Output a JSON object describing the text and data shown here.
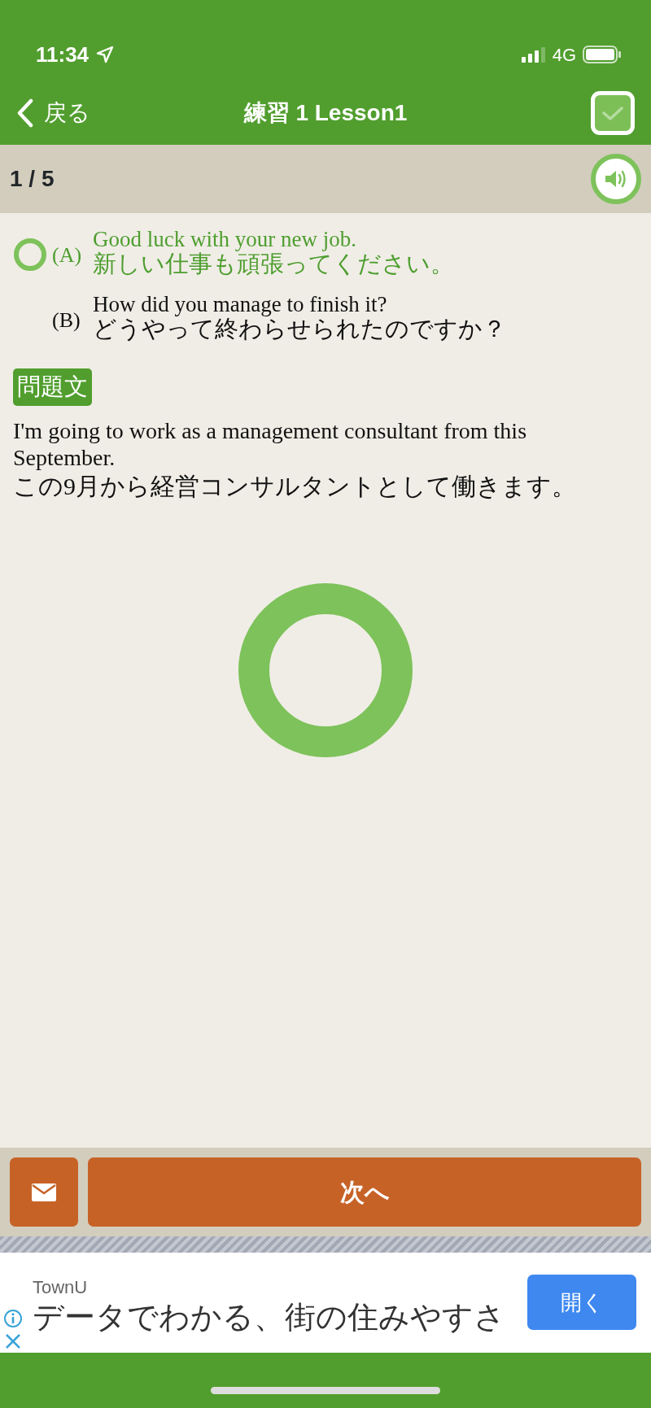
{
  "status_bar": {
    "time": "11:34",
    "network": "4G"
  },
  "nav": {
    "back": "戻る",
    "title": "練習 1 Lesson1"
  },
  "progress": {
    "counter": "1 / 5"
  },
  "options": [
    {
      "label": "(A)",
      "english": "Good luck with your new job.",
      "japanese": "新しい仕事も頑張ってください。",
      "selected": true
    },
    {
      "label": "(B)",
      "english": "How did you manage to finish it?",
      "japanese": "どうやって終わらせられたのですか？",
      "selected": false
    }
  ],
  "question": {
    "badge": "問題文",
    "english": "I'm going to work as a management consultant from this September.",
    "japanese": "この9月から経営コンサルタントとして働きます。"
  },
  "result": {
    "kind": "correct"
  },
  "next_button": "次へ",
  "ad": {
    "advertiser": "TownU",
    "headline": "データでわかる、街の住みやすさ",
    "button": "開く"
  }
}
